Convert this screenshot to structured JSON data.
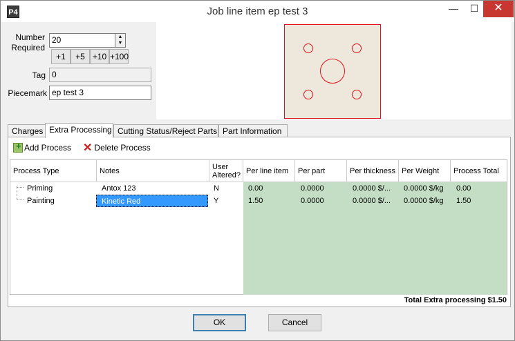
{
  "window": {
    "title": "Job line item ep test 3",
    "app_icon": "P4"
  },
  "titlebar": {
    "min": "—",
    "max": "☐",
    "close": "✕"
  },
  "form": {
    "number_label_1": "Number",
    "number_label_2": "Required",
    "number_value": "20",
    "increments": [
      "+1",
      "+5",
      "+10",
      "+100"
    ],
    "tag_label": "Tag",
    "tag_value": "0",
    "piecemark_label": "Piecemark",
    "piecemark_value": "ep test 3"
  },
  "tabs": [
    "Charges",
    "Extra Processing",
    "Cutting Status/Reject Parts",
    "Part Information"
  ],
  "active_tab": "Extra Processing",
  "toolbar": {
    "add_label": "Add Process",
    "delete_label": "Delete Process"
  },
  "grid": {
    "columns": [
      "Process Type",
      "Notes",
      "User Altered?",
      "Per line item",
      "Per part",
      "Per thickness",
      "Per Weight",
      "Process Total"
    ],
    "rows": [
      {
        "type": "Priming",
        "notes": "Antox 123",
        "altered": "N",
        "per_line": "0.00",
        "per_part": "0.0000",
        "per_thickness": "0.0000 $/...",
        "per_weight": "0.0000 $/kg",
        "total": "0.00"
      },
      {
        "type": "Painting",
        "notes": "Kinetic Red",
        "altered": "Y",
        "per_line": "1.50",
        "per_part": "0.0000",
        "per_thickness": "0.0000 $/...",
        "per_weight": "0.0000 $/kg",
        "total": "1.50"
      }
    ],
    "footer_total": "Total Extra processing $1.50"
  },
  "buttons": {
    "ok": "OK",
    "cancel": "Cancel"
  },
  "colors": {
    "close": "#c7372f",
    "grid_green": "#c3dec4",
    "selection": "#3399ff",
    "plate_fill": "#ede8db",
    "plate_stroke": "#e0101a"
  }
}
